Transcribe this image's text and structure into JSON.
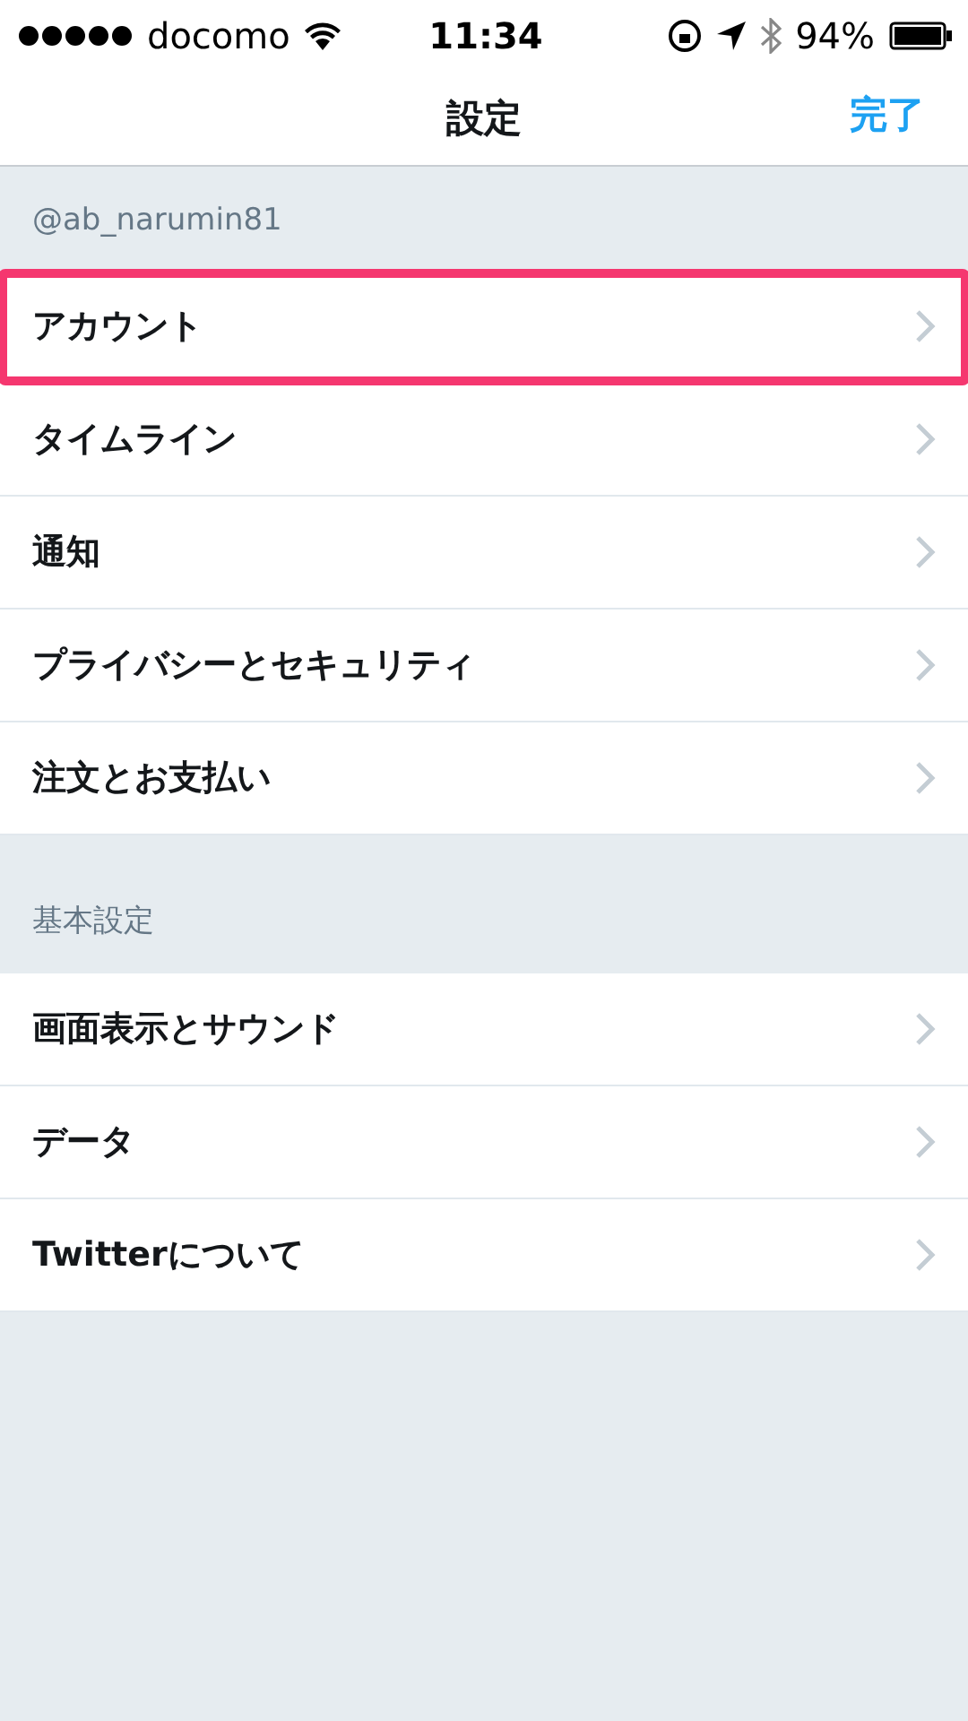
{
  "status_bar": {
    "carrier": "docomo",
    "time": "11:34",
    "battery": "94%"
  },
  "nav": {
    "title": "設定",
    "done": "完了"
  },
  "sections": [
    {
      "header": "@ab_narumin81",
      "items": [
        {
          "label": "アカウント",
          "highlighted": true
        },
        {
          "label": "タイムライン",
          "highlighted": false
        },
        {
          "label": "通知",
          "highlighted": false
        },
        {
          "label": "プライバシーとセキュリティ",
          "highlighted": false
        },
        {
          "label": "注文とお支払い",
          "highlighted": false
        }
      ]
    },
    {
      "header": "基本設定",
      "items": [
        {
          "label": "画面表示とサウンド",
          "highlighted": false
        },
        {
          "label": "データ",
          "highlighted": false
        },
        {
          "label": "Twitterについて",
          "highlighted": false
        }
      ]
    }
  ]
}
